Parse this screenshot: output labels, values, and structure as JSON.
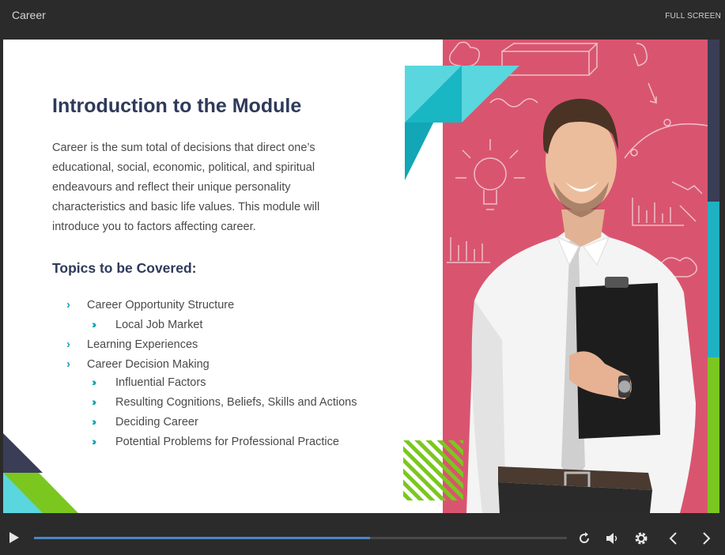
{
  "window": {
    "title": "Career",
    "fullscreen_label": "FULL SCREEN"
  },
  "slide": {
    "heading": "Introduction to the Module",
    "intro": "Career is the sum total of decisions that direct one’s educational, social, economic, political, and spiritual endeavours and reflect their unique personality characteristics and basic life values.  This module will introduce you to factors affecting career.",
    "topics_heading": "Topics to be Covered:",
    "topics": [
      {
        "label": "Career Opportunity Structure",
        "level": 1
      },
      {
        "label": "Local Job Market",
        "level": 2
      },
      {
        "label": "Learning Experiences",
        "level": 1
      },
      {
        "label": "Career Decision Making",
        "level": 1
      },
      {
        "label": "Influential Factors",
        "level": 2
      },
      {
        "label": "Resulting Cognitions, Beliefs, Skills and Actions",
        "level": 2
      },
      {
        "label": "Deciding Career",
        "level": 2
      },
      {
        "label": "Potential Problems for Professional Practice",
        "level": 2
      }
    ]
  },
  "player": {
    "progress_fraction": 0.63,
    "icons": [
      "play-icon",
      "replay-icon",
      "volume-icon",
      "settings-gear-icon",
      "previous-arrow-icon",
      "next-arrow-icon"
    ]
  },
  "colors": {
    "accent_teal": "#13a6b6",
    "accent_green": "#7bc71f",
    "navy": "#2f3a5a",
    "photo_pink": "#d9556f",
    "progress": "#4a86c8"
  }
}
